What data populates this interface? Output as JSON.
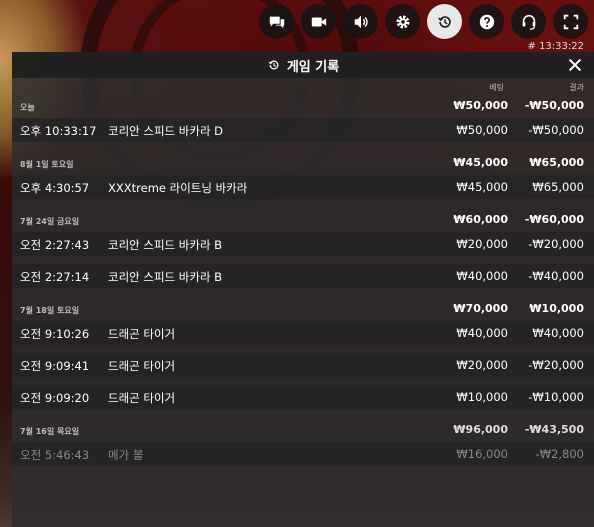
{
  "clock": "# 13:33:22",
  "controls": [
    {
      "name": "chat-icon",
      "label": ""
    },
    {
      "name": "video-icon",
      "label": ""
    },
    {
      "name": "sound-icon",
      "label": ""
    },
    {
      "name": "settings-icon",
      "label": ""
    },
    {
      "name": "history-icon",
      "label": ""
    },
    {
      "name": "help-icon",
      "label": ""
    },
    {
      "name": "support-icon",
      "label": ""
    },
    {
      "name": "fullscreen-icon",
      "label": ""
    }
  ],
  "panel": {
    "title": "게임 기록",
    "col_bet": "베팅",
    "col_result": "결과",
    "groups": [
      {
        "label": "오늘",
        "bet": "₩50,000",
        "result": "-₩50,000",
        "rows": [
          {
            "time": "오후 10:33:17",
            "game": "코리안 스피드 바카라 D",
            "bet": "₩50,000",
            "result": "-₩50,000"
          }
        ]
      },
      {
        "label": "8월 1일 토요일",
        "bet": "₩45,000",
        "result": "₩65,000",
        "rows": [
          {
            "time": "오후 4:30:57",
            "game": "XXXtreme 라이트닝 바카라",
            "bet": "₩45,000",
            "result": "₩65,000"
          }
        ]
      },
      {
        "label": "7월 24일 금요일",
        "bet": "₩60,000",
        "result": "-₩60,000",
        "rows": [
          {
            "time": "오전 2:27:43",
            "game": "코리안 스피드 바카라 B",
            "bet": "₩20,000",
            "result": "-₩20,000"
          },
          {
            "time": "오전 2:27:14",
            "game": "코리안 스피드 바카라 B",
            "bet": "₩40,000",
            "result": "-₩40,000"
          }
        ]
      },
      {
        "label": "7월 18일 토요일",
        "bet": "₩70,000",
        "result": "₩10,000",
        "rows": [
          {
            "time": "오전 9:10:26",
            "game": "드래곤 타이거",
            "bet": "₩40,000",
            "result": "₩40,000"
          },
          {
            "time": "오전 9:09:41",
            "game": "드래곤 타이거",
            "bet": "₩20,000",
            "result": "-₩20,000"
          },
          {
            "time": "오전 9:09:20",
            "game": "드래곤 타이거",
            "bet": "₩10,000",
            "result": "-₩10,000"
          }
        ]
      },
      {
        "label": "7월 16일 목요일",
        "bet": "₩96,000",
        "result": "-₩43,500",
        "rows": [
          {
            "time": "오전 5:46:43",
            "game": "메가 볼",
            "bet": "₩16,000",
            "result": "-₩2,800"
          }
        ]
      }
    ]
  }
}
